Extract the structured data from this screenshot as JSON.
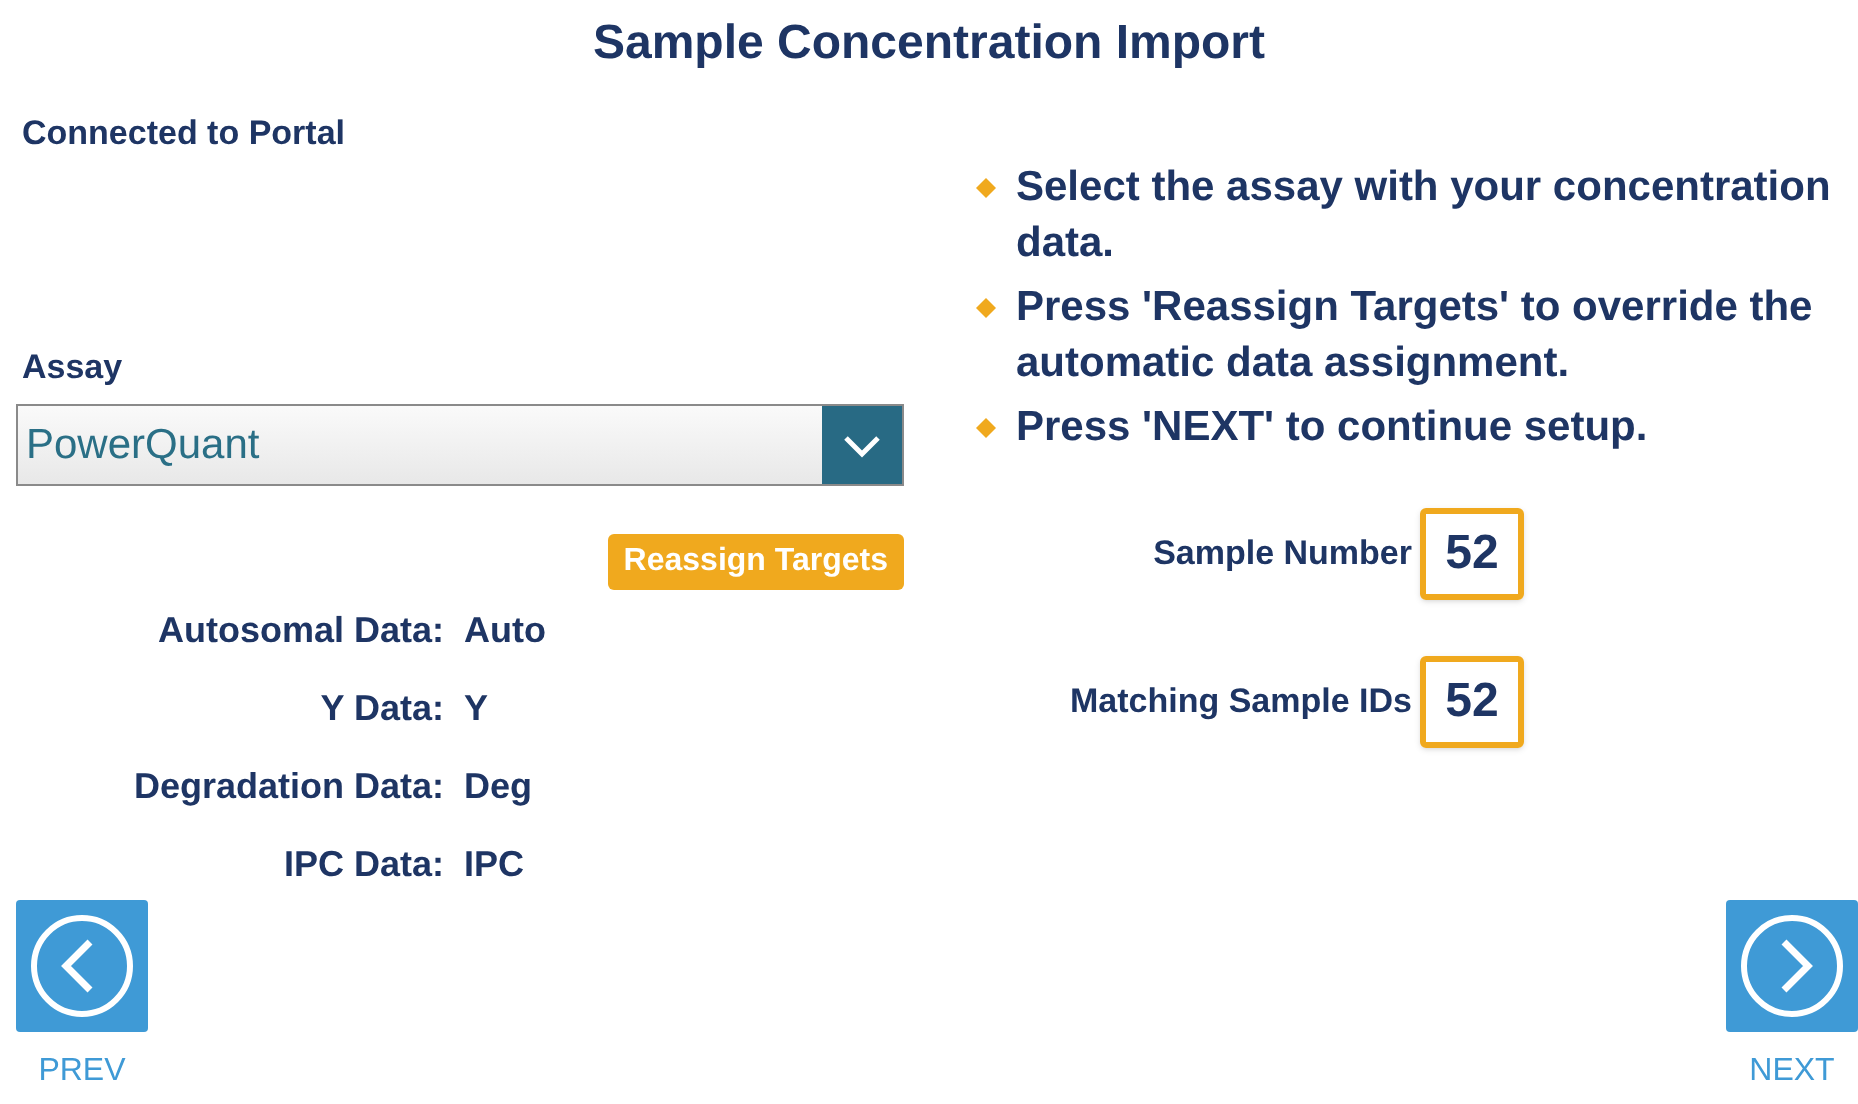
{
  "title": "Sample Concentration Import",
  "connection_status": "Connected to Portal",
  "assay": {
    "label": "Assay",
    "value": "PowerQuant"
  },
  "reassign_button": "Reassign Targets",
  "data_assignments": [
    {
      "label": "Autosomal Data:",
      "value": "Auto"
    },
    {
      "label": "Y Data:",
      "value": "Y"
    },
    {
      "label": "Degradation Data:",
      "value": "Deg"
    },
    {
      "label": "IPC Data:",
      "value": "IPC"
    }
  ],
  "instructions": [
    "Select the assay with your concentration data.",
    "Press 'Reassign Targets' to override the automatic data assignment.",
    "Press 'NEXT' to continue setup."
  ],
  "counts": [
    {
      "label": "Sample Number",
      "value": "52"
    },
    {
      "label": "Matching Sample IDs",
      "value": "52"
    }
  ],
  "nav": {
    "prev": "PREV",
    "next": "NEXT"
  }
}
